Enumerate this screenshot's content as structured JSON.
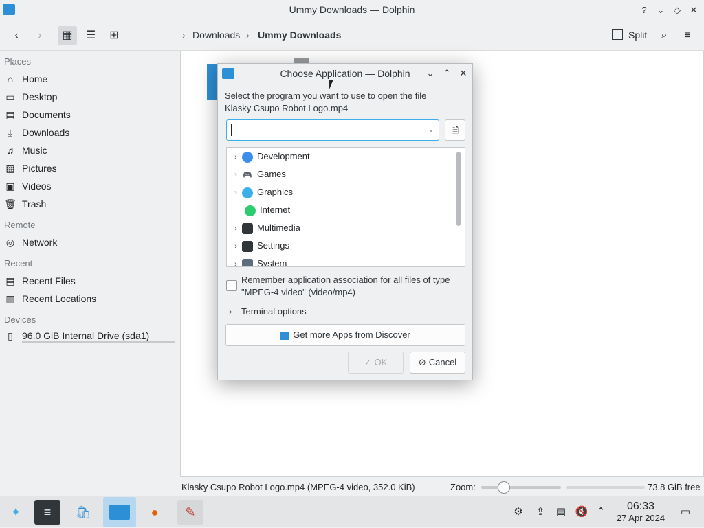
{
  "window": {
    "title": "Ummy Downloads — Dolphin",
    "buttons": {
      "help": "?",
      "minimize": "⌄",
      "maximize": "◇",
      "close": "✕"
    }
  },
  "toolbar": {
    "breadcrumb": [
      "Downloads",
      "Ummy Downloads"
    ],
    "split_label": "Split"
  },
  "sidebar": {
    "places_header": "Places",
    "places": [
      "Home",
      "Desktop",
      "Documents",
      "Downloads",
      "Music",
      "Pictures",
      "Videos",
      "Trash"
    ],
    "remote_header": "Remote",
    "remote": [
      "Network"
    ],
    "recent_header": "Recent",
    "recent": [
      "Recent Files",
      "Recent Locations"
    ],
    "devices_header": "Devices",
    "devices": [
      "96.0 GiB Internal Drive (sda1)"
    ]
  },
  "status": {
    "file_info": "Klasky Csupo Robot Logo.mp4 (MPEG-4 video, 352.0 KiB)",
    "zoom_label": "Zoom:",
    "free_space": "73.8 GiB free"
  },
  "dialog": {
    "title": "Choose Application — Dolphin",
    "prompt_line1": "Select the program you want to use to open the file",
    "prompt_line2": "Klasky Csupo Robot Logo.mp4",
    "combo_value": "",
    "categories": [
      "Development",
      "Games",
      "Graphics",
      "Internet",
      "Multimedia",
      "Settings",
      "System"
    ],
    "remember_line1": "Remember application association for all files of type",
    "remember_line2": "\"MPEG-4 video\" (video/mp4)",
    "terminal_options": "Terminal options",
    "discover_button": "Get more Apps from Discover",
    "ok_button": "OK",
    "cancel_button": "Cancel"
  },
  "taskbar": {
    "time": "06:33",
    "date": "27 Apr 2024"
  },
  "colors": {
    "accent": "#3daee9",
    "folder_blue": "#2d8fd5",
    "background": "#eff0f1"
  }
}
